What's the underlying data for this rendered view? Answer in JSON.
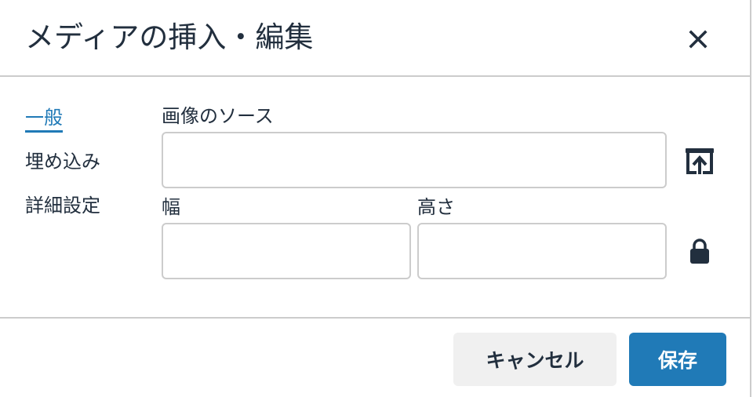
{
  "dialog": {
    "title": "メディアの挿入・編集",
    "close_icon": "close-icon"
  },
  "tabs": [
    {
      "label": "一般",
      "active": true
    },
    {
      "label": "埋め込み",
      "active": false
    },
    {
      "label": "詳細設定",
      "active": false
    }
  ],
  "general": {
    "source": {
      "label": "画像のソース",
      "value": "",
      "upload_icon": "upload-icon"
    },
    "width": {
      "label": "幅",
      "value": ""
    },
    "height": {
      "label": "高さ",
      "value": ""
    },
    "lock_icon": "lock-icon"
  },
  "footer": {
    "cancel_label": "キャンセル",
    "save_label": "保存"
  },
  "colors": {
    "accent": "#207ab7",
    "text": "#222f3e",
    "border": "#cccccc",
    "secondary_button_bg": "#f0f0f0"
  }
}
